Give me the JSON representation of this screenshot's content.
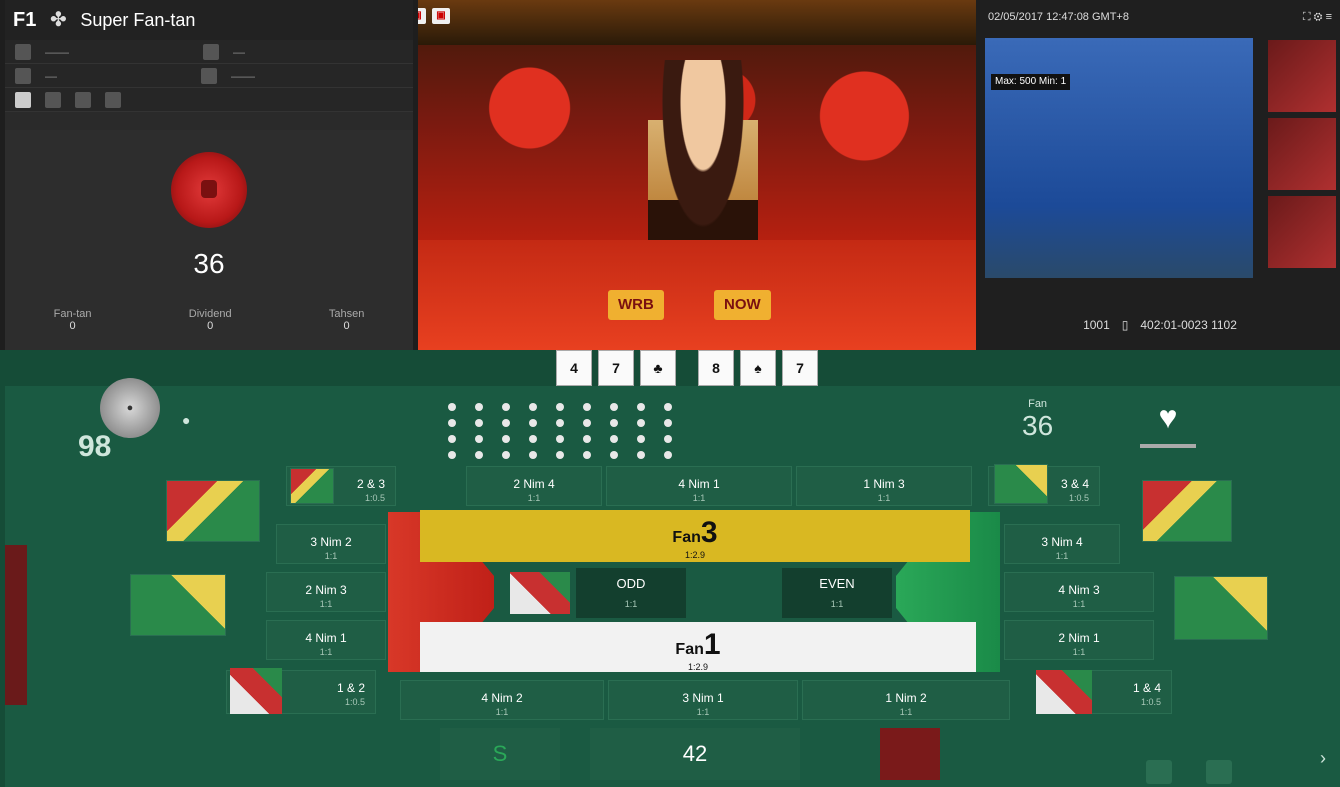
{
  "lobby": {
    "table_no": "F1",
    "table_name": "Super Fan-tan",
    "info_rows": [
      {
        "left": "——",
        "right": "—"
      },
      {
        "left": "—",
        "right": "——"
      }
    ],
    "current_number": "36",
    "stats": [
      {
        "label": "Fan-tan",
        "value": "0"
      },
      {
        "label": "Dividend",
        "value": "0"
      },
      {
        "label": "Tahsen",
        "value": "0"
      }
    ]
  },
  "video": {
    "icons": [
      "HD",
      "▣",
      "▣"
    ],
    "signs": [
      "WRB",
      "NOW"
    ]
  },
  "right_panel": {
    "header": "02/05/2017 12:47:08 GMT+8",
    "pool_label": "Max: 500 Min: 1",
    "footer_left": "1001",
    "footer_right": "402:01-0023 1102"
  },
  "cards": [
    "4",
    "7",
    "♣",
    "8",
    "♠",
    "7"
  ],
  "board": {
    "player_score": "98",
    "player_mark": "●",
    "round_label": "Fan",
    "round_count": "36",
    "bets": {
      "t1": {
        "label": "2 Nim 4",
        "odds": "1:1"
      },
      "t2": {
        "label": "4 Nim 1",
        "odds": "1:1"
      },
      "t3": {
        "label": "1 Nim 3",
        "odds": "1:1"
      },
      "l1": {
        "label": "3 Nim 2",
        "odds": "1:1"
      },
      "l2": {
        "label": "2 Nim 3",
        "odds": "1:1"
      },
      "l3": {
        "label": "4 Nim 1",
        "odds": "1:1"
      },
      "r1": {
        "label": "3 Nim 4",
        "odds": "1:1"
      },
      "r2": {
        "label": "4 Nim 3",
        "odds": "1:1"
      },
      "r3": {
        "label": "2 Nim 1",
        "odds": "1:1"
      },
      "b1": {
        "label": "4 Nim 2",
        "odds": "1:1"
      },
      "b2": {
        "label": "3 Nim 1",
        "odds": "1:1"
      },
      "b3": {
        "label": "1 Nim 2",
        "odds": "1:1"
      },
      "k1": {
        "label": "2 & 3",
        "odds": "1:0.5"
      },
      "k2": {
        "label": "3 & 4",
        "odds": "1:0.5"
      },
      "k3": {
        "label": "1 & 2",
        "odds": "1:0.5"
      },
      "k4": {
        "label": "1 & 4",
        "odds": "1:0.5"
      },
      "odd": {
        "label": "ODD",
        "odds": "1:1"
      },
      "even": {
        "label": "EVEN",
        "odds": "1:1"
      }
    },
    "fan3": {
      "label": "Fan",
      "num": "3",
      "odds": "1:2.9"
    },
    "fan1": {
      "label": "Fan",
      "num": "1",
      "odds": "1:2.9"
    },
    "footer": [
      "S",
      "42",
      ""
    ]
  }
}
